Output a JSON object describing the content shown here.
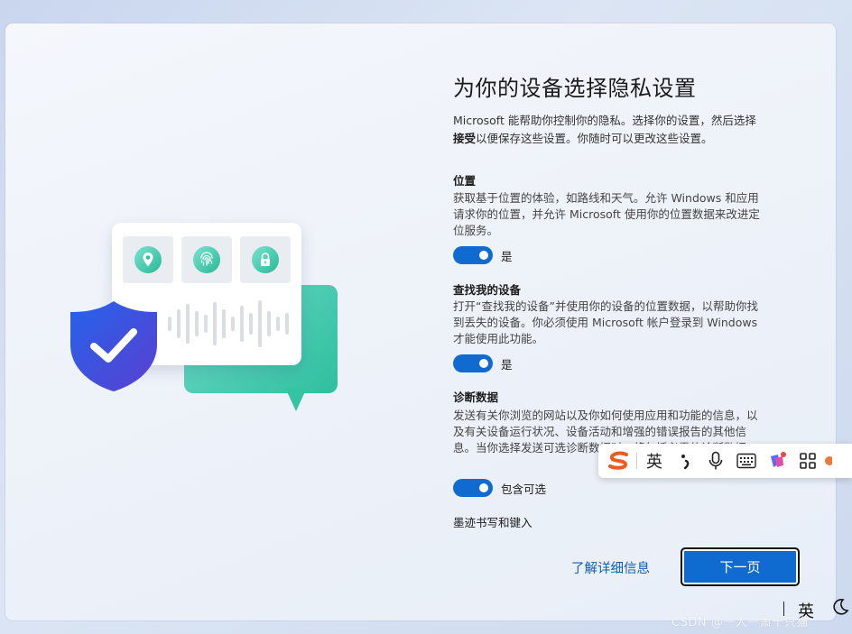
{
  "title": "为你的设备选择隐私设置",
  "intro": {
    "line1": "Microsoft 能帮助你控制你的隐私。选择你的设置，然后选择",
    "accept_word": "接受",
    "line2_rest": "以便保存这些设置。你随时可以更改这些设置。"
  },
  "sections": [
    {
      "title": "位置",
      "body": "获取基于位置的体验，如路线和天气。允许 Windows 和应用请求你的位置，并允许 Microsoft 使用你的位置数据来改进定位服务。",
      "toggle_on": true,
      "toggle_label": "是"
    },
    {
      "title": "查找我的设备",
      "body": "打开“查找我的设备”并使用你的设备的位置数据，以帮助你找到丢失的设备。你必须使用 Microsoft 帐户登录到 Windows 才能使用此功能。",
      "toggle_on": true,
      "toggle_label": "是"
    },
    {
      "title": "诊断数据",
      "body": "发送有关你浏览的网站以及你如何使用应用和功能的信息，以及有关设备运行状况、设备活动和增强的错误报告的其他信息。当你选择发送可选诊断数据时，将包括必需的诊断数据。",
      "toggle_on": true,
      "toggle_label": "包含可选"
    },
    {
      "title": "墨迹书写和键入"
    }
  ],
  "footer": {
    "learn_more": "了解详细信息",
    "next": "下一页"
  },
  "ime_toolbar": {
    "logo_icon": "sogou-s-icon",
    "lang": "英",
    "items": [
      "punctuation-icon",
      "microphone-icon",
      "keyboard-icon",
      "skin-icon",
      "apps-grid-icon"
    ]
  },
  "tray": {
    "ime_lang": "英",
    "moon_icon": "moon-icon"
  },
  "watermark": "CSDN @一人一萧十只猫",
  "colors": {
    "accent": "#0f6bd0",
    "link": "#0b5fb8",
    "illustration_green": "#2fbf9f",
    "shield_blue": "#2a4fd6"
  }
}
